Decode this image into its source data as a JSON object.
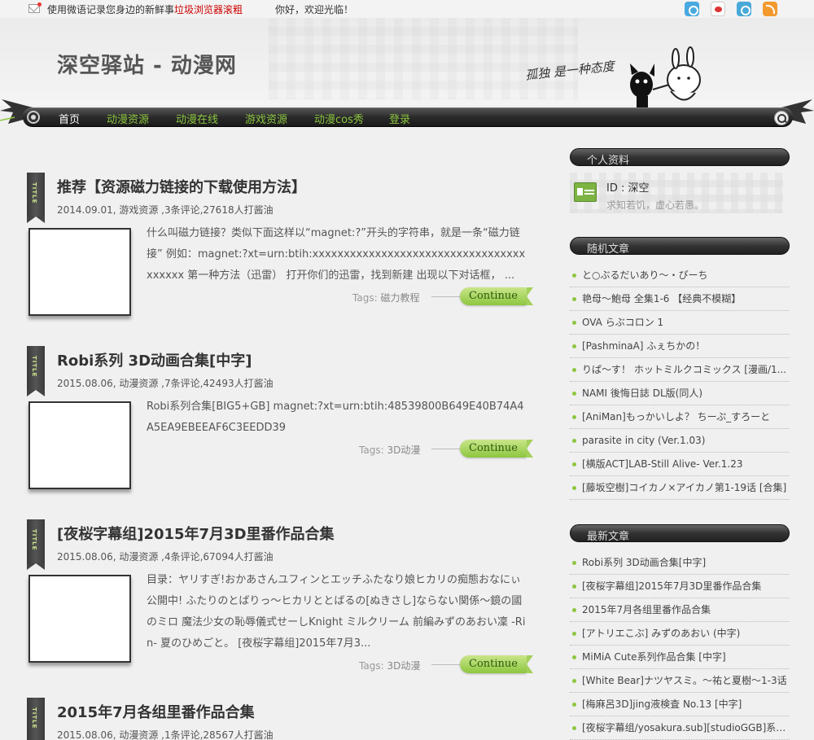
{
  "topbar": {
    "notice_text": "使用微语记录您身边的新鲜事",
    "notice_hot": "垃圾浏览器滚粗",
    "welcome": "你好，欢迎光临！"
  },
  "header": {
    "site_title": "深空驿站 - 动漫网",
    "logo_text": "孤独 是一种态度"
  },
  "nav": {
    "items": [
      {
        "label": "首页"
      },
      {
        "label": "动漫资源"
      },
      {
        "label": "动漫在线"
      },
      {
        "label": "游戏资源"
      },
      {
        "label": "动漫cos秀"
      },
      {
        "label": "登录"
      }
    ]
  },
  "ribbon_label": "TITLE",
  "posts": [
    {
      "title": "推荐【资源磁力链接的下载使用方法】",
      "meta": "2014.09.01, 游戏资源 ,3条评论,27618人打酱油",
      "excerpt": "什么叫磁力链接？类似下面这样以“magnet:?”开头的字符串，就是一条“磁力链接” 例如：magnet:?xt=urn:btih:xxxxxxxxxxxxxxxxxxxxxxxxxxxxxxxxxxxxxxxx 第一种方法（迅雷） 打开你们的迅雷，找到新建 出现以下对话框， ...",
      "tags_label": "Tags:",
      "tag": "磁力教程",
      "continue": "Continue"
    },
    {
      "title": "Robi系列 3D动画合集[中字]",
      "meta": "2015.08.06, 动漫资源 ,7条评论,42493人打酱油",
      "excerpt": "Robi系列合集[BIG5+GB] magnet:?xt=urn:btih:48539800B649E40B74A4A5EA9EBEEAF6C3EEDD39",
      "tags_label": "Tags:",
      "tag": "3D动漫",
      "continue": "Continue"
    },
    {
      "title": "[夜桜字幕组]2015年7月3D里番作品合集",
      "meta": "2015.08.06, 动漫资源 ,4条评论,67094人打酱油",
      "excerpt": "目录：ヤリすぎ!おかあさんユフィンとエッチふたなり娘ヒカリの痴態おなにぃ公開中! ふたりのとばりっ～ヒカリととばるの[ぬきさし]ならない関係～鏡の國のミロ 魔法少女の恥辱儀式せーしKnight ミルクリーム 前編みずのあおい凜 -Rin- 夏のひめごと。 [夜桜字幕组]2015年7月3...",
      "tags_label": "Tags:",
      "tag": "3D动漫",
      "continue": "Continue"
    },
    {
      "title": "2015年7月各组里番作品合集",
      "meta": "2015.08.06, 动漫资源 ,1条评论,28567人打酱油"
    }
  ],
  "sidebar": {
    "profile": {
      "heading": "个人资料",
      "id": "ID : 深空",
      "bio": "求知若饥，虚心若愚。"
    },
    "random": {
      "heading": "随机文章",
      "items": [
        "と○ぶるだいあり～・ぴーち",
        "艳母～鮑母 全集1-6 【经典不模糊】",
        "OVA らぶコロン 1",
        "[PashminaA] ふぇちかの！",
        "りぱ～す！ ホットミルクコミックス [漫画/1...",
        "NAMI 後悔日誌 DL版(同人)",
        "[AniMan]もっかいしよ？ ちーぷ_すろーと",
        "parasite in city (Ver.1.03)",
        "[横版ACT]LAB-Still Alive- Ver.1.23",
        "[藤坂空樹]コイカノ×アイカノ第1-19话 [合集]"
      ]
    },
    "latest": {
      "heading": "最新文章",
      "items": [
        "Robi系列 3D动画合集[中字]",
        "[夜桜字幕组]2015年7月3D里番作品合集",
        "2015年7月各组里番作品合集",
        "[アトリエこぶ] みずのあおい (中字)",
        "MiMiA Cute系列作品合集 [中字]",
        "[White Bear]ナツヤスミ。～祐と夏樹～1-3话",
        "[梅麻呂3D]jing液検査 No.13 [中字]",
        "[夜桜字幕组/yosakura.sub][studioGGB]系列..."
      ]
    }
  }
}
